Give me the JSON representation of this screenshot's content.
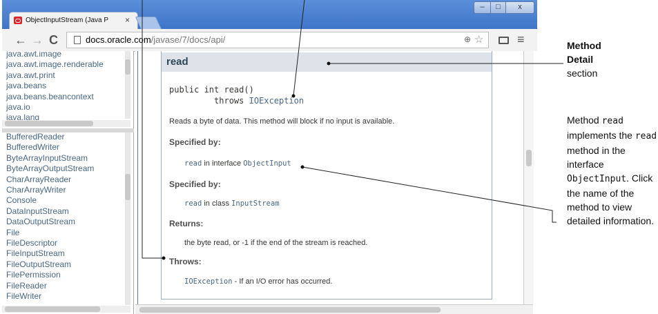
{
  "browser": {
    "tab_title": "ObjectInputStream (Java P",
    "tab_close": "×",
    "window_controls": {
      "minimize": "–",
      "maximize": "□",
      "close": "x"
    },
    "nav": {
      "back": "←",
      "forward": "→",
      "reload": "C"
    },
    "url_host": "docs.oracle.com",
    "url_path": "/javase/7/docs/api/",
    "zoom_icon": "⊕",
    "star_icon": "☆",
    "menu_icon": "≡"
  },
  "package_frame": {
    "items": [
      "java.awt.image",
      "java.awt.image.renderable",
      "java.awt.print",
      "java.beans",
      "java.beans.beancontext",
      "java.io",
      "java.lang"
    ]
  },
  "class_frame": {
    "items": [
      "BufferedReader",
      "BufferedWriter",
      "ByteArrayInputStream",
      "ByteArrayOutputStream",
      "CharArrayReader",
      "CharArrayWriter",
      "Console",
      "DataInputStream",
      "DataOutputStream",
      "File",
      "FileDescriptor",
      "FileInputStream",
      "FileOutputStream",
      "FilePermission",
      "FileReader",
      "FileWriter"
    ]
  },
  "method_detail": {
    "name": "read",
    "signature_line1": "public int read()",
    "signature_throws": "throws",
    "signature_exception": "IOException",
    "description": "Reads a byte of data. This method will block if no input is available.",
    "specified_by_1": {
      "label": "Specified by:",
      "method": "read",
      "text": " in interface ",
      "type": "ObjectInput"
    },
    "specified_by_2": {
      "label": "Specified by:",
      "method": "read",
      "text": " in class ",
      "type": "InputStream"
    },
    "returns": {
      "label": "Returns:",
      "text": "the byte read, or -1 if the end of the stream is reached."
    },
    "throws": {
      "label": "Throws:",
      "exception": "IOException",
      "text": " - If an I/O error has occurred."
    }
  },
  "callouts": {
    "detail_line1": "Method",
    "detail_line2": "Detail",
    "detail_line3": "section",
    "read_p1": "Method ",
    "read_code1": "read",
    "read_p2": " implements the ",
    "read_code2": "read",
    "read_p3": " method in the interface ",
    "read_code3": "ObjectInput",
    "read_p4": ". Click the name of the method to view detailed information."
  },
  "colors": {
    "link": "#4a6782",
    "header_bg": "#dee3e9",
    "title_bar": "#3e75c8",
    "favicon": "#d8262c"
  }
}
